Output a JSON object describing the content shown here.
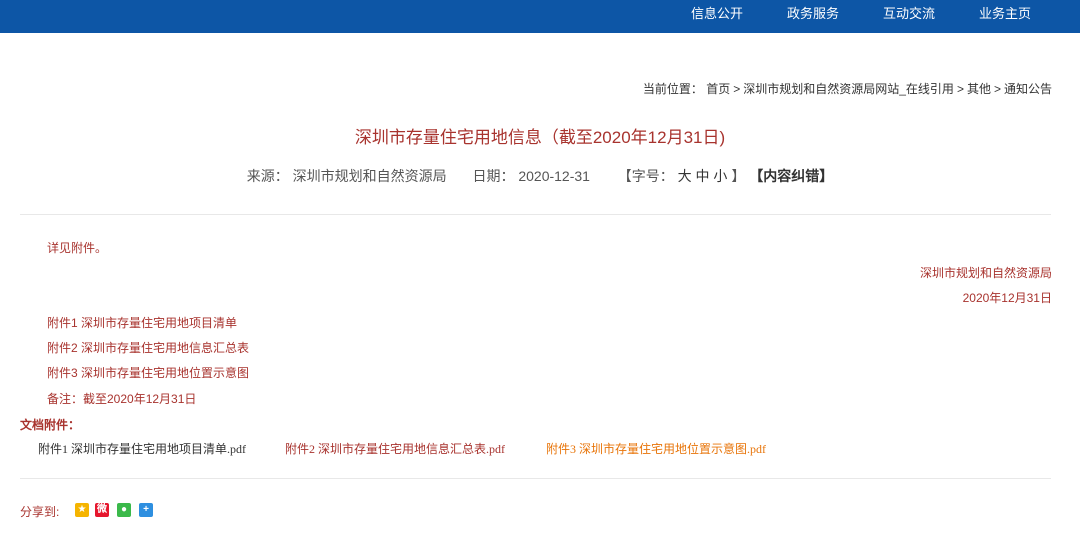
{
  "topnav": [
    "信息公开",
    "政务服务",
    "互动交流",
    "业务主页"
  ],
  "breadcrumb": {
    "label": "当前位置：",
    "items": [
      "首页",
      "深圳市规划和自然资源局网站_在线引用",
      "其他",
      "通知公告"
    ],
    "separator": ">"
  },
  "article": {
    "title": "深圳市存量住宅用地信息（截至2020年12月31日)",
    "source_label": "来源：",
    "source": "深圳市规划和自然资源局",
    "date_label": "日期：",
    "date": "2020-12-31",
    "font_label": "【字号：",
    "font_sizes": [
      "大",
      "中",
      "小"
    ],
    "font_close": "】",
    "correction": "【内容纠错】",
    "body_intro": "详见附件。",
    "signature_org": "深圳市规划和自然资源局",
    "signature_date": "2020年12月31日",
    "attachment_lines": [
      "附件1 深圳市存量住宅用地项目清单",
      "附件2 深圳市存量住宅用地信息汇总表",
      "附件3 深圳市存量住宅用地位置示意图"
    ],
    "note": "备注：截至2020年12月31日"
  },
  "doc_attachments": {
    "label": "文档附件：",
    "files": [
      "附件1 深圳市存量住宅用地项目清单.pdf",
      "附件2 深圳市存量住宅用地信息汇总表.pdf",
      "附件3 深圳市存量住宅用地位置示意图.pdf"
    ]
  },
  "share": {
    "label": "分享到:",
    "icons": [
      "qzone-icon",
      "weibo-icon",
      "wechat-icon",
      "more-share-icon"
    ]
  },
  "colors": {
    "nav_bg": "#0d56a6",
    "accent_red": "#a8332e",
    "file1": "#333333",
    "file2": "#a8332e",
    "file3": "#e8750a"
  }
}
